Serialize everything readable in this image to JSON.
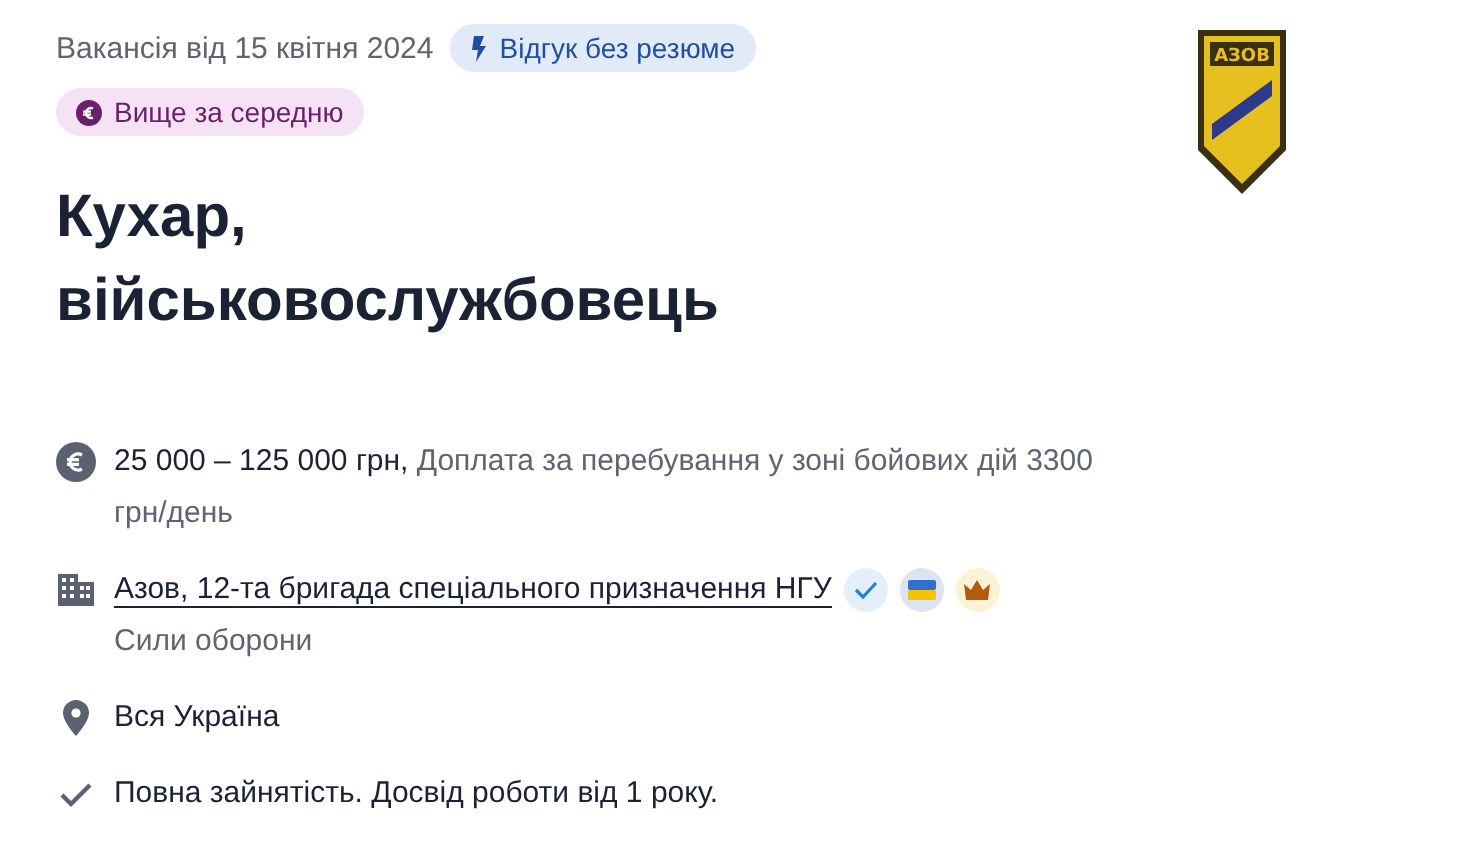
{
  "posted": "Вакансія від 15 квітня 2024",
  "badges": [
    {
      "kind": "quick-apply",
      "label": "Відгук без резюме"
    },
    {
      "kind": "salary-level",
      "label": "Вище за середню"
    }
  ],
  "title": "Кухар, військовослужбовець",
  "logo": {
    "text": "АЗОВ"
  },
  "salary": {
    "amount": "25 000 – 125 000 грн,",
    "note": "Доплата за перебування у зоні бойових дій 3300 грн/день"
  },
  "company": {
    "name": "Азов, 12-та бригада спеціального призначення НГУ",
    "marks": [
      {
        "kind": "verified"
      },
      {
        "kind": "flag"
      },
      {
        "kind": "crown"
      }
    ],
    "sector": "Сили оборони"
  },
  "location": "Вся Україна",
  "conditions": "Повна зайнятість. Досвід роботи від 1 року."
}
